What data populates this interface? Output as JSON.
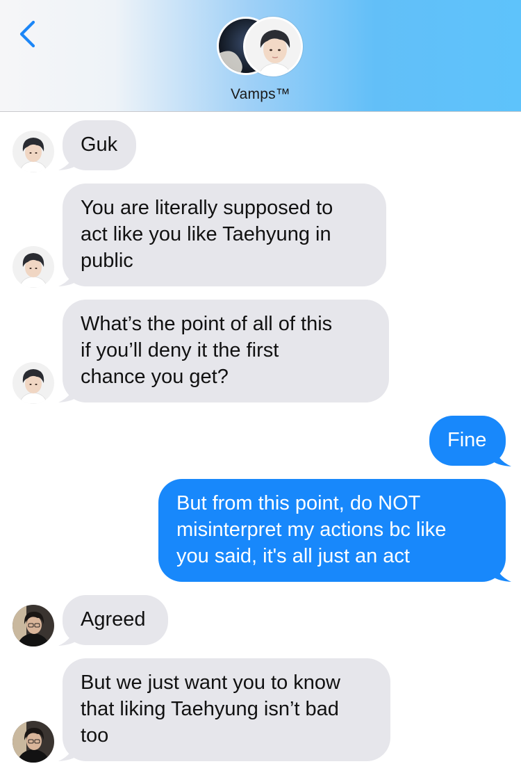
{
  "header": {
    "back_icon": "chevron-left-icon",
    "group_name": "Vamps™",
    "colors": {
      "accent": "#1c86f7",
      "gradient_right": "#5ec3fb"
    }
  },
  "thread": {
    "colors": {
      "incoming_bubble": "#e6e6eb",
      "outgoing_bubble": "#1888fb"
    },
    "messages": [
      {
        "direction": "incoming",
        "sender_avatar": "pale-hair-avatar",
        "lines": [
          "Guk"
        ]
      },
      {
        "direction": "incoming",
        "sender_avatar": "pale-hair-avatar",
        "lines": [
          "You are literally supposed to",
          "act like you like Taehyung in",
          "public"
        ]
      },
      {
        "direction": "incoming",
        "sender_avatar": "pale-hair-avatar",
        "lines": [
          "What’s the point of all of this",
          "if you’ll deny it the first",
          "chance you get?"
        ]
      },
      {
        "direction": "outgoing",
        "lines": [
          "Fine"
        ]
      },
      {
        "direction": "outgoing",
        "lines": [
          "But from this point, do NOT",
          "misinterpret my actions bc like",
          "you said, it's all just an act"
        ]
      },
      {
        "direction": "incoming",
        "sender_avatar": "dark-hair-avatar",
        "lines": [
          "Agreed"
        ]
      },
      {
        "direction": "incoming",
        "sender_avatar": "dark-hair-avatar",
        "lines": [
          "But we just want you to know",
          "that liking Taehyung isn’t bad",
          "too"
        ]
      }
    ]
  }
}
